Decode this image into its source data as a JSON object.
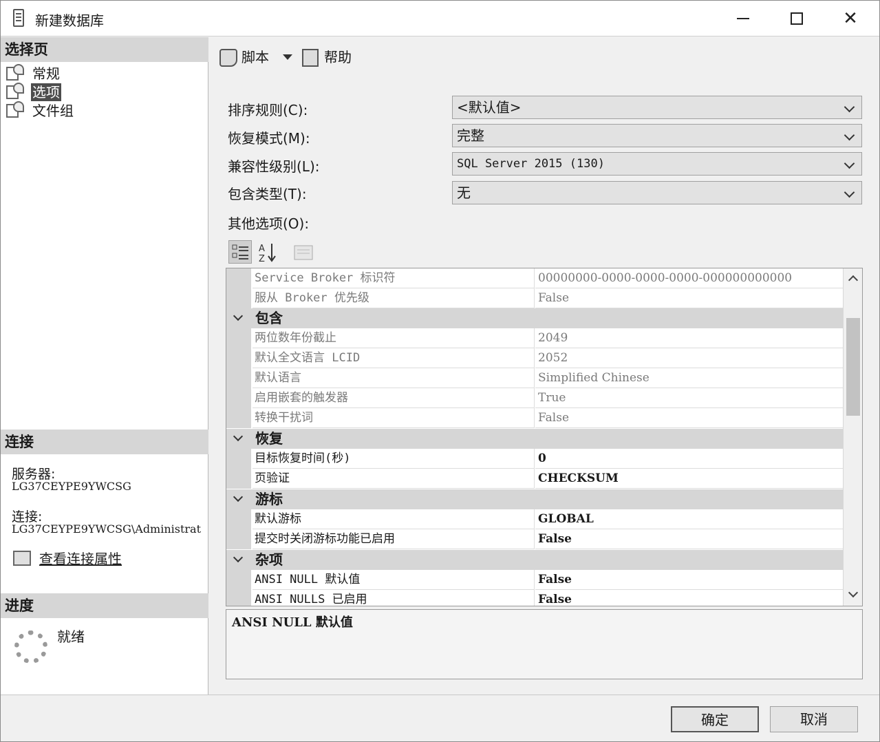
{
  "window": {
    "title": "新建数据库"
  },
  "left": {
    "select_page_header": "选择页",
    "nav_items": [
      {
        "label": "常规",
        "selected": false
      },
      {
        "label": "选项",
        "selected": true
      },
      {
        "label": "文件组",
        "selected": false
      }
    ],
    "connection_header": "连接",
    "server_label": "服务器:",
    "server_value": "LG37CEYPE9YWCSG",
    "connection_label": "连接:",
    "connection_value": "LG37CEYPE9YWCSG\\Administrat",
    "view_properties_link": "查看连接属性",
    "progress_header": "进度",
    "progress_status": "就绪"
  },
  "toolbar": {
    "script_label": "脚本",
    "help_label": "帮助"
  },
  "form": {
    "collation_label": "排序规则(C):",
    "collation_value": "<默认值>",
    "recovery_label": "恢复模式(M):",
    "recovery_value": "完整",
    "compat_label": "兼容性级别(L):",
    "compat_value": "SQL Server 2015 (130)",
    "containment_label": "包含类型(T):",
    "containment_value": "无",
    "other_label": "其他选项(O):"
  },
  "grid": {
    "rows": [
      {
        "kind": "prop",
        "name": "Service Broker 标识符",
        "value": "00000000-0000-0000-0000-000000000000",
        "readonly": true
      },
      {
        "kind": "prop",
        "name": "服从 Broker 优先级",
        "value": "False",
        "readonly": true
      },
      {
        "kind": "cat",
        "name": "包含"
      },
      {
        "kind": "prop",
        "name": "两位数年份截止",
        "value": "2049",
        "readonly": true
      },
      {
        "kind": "prop",
        "name": "默认全文语言 LCID",
        "value": "2052",
        "readonly": true
      },
      {
        "kind": "prop",
        "name": "默认语言",
        "value": "Simplified Chinese",
        "readonly": true
      },
      {
        "kind": "prop",
        "name": "启用嵌套的触发器",
        "value": "True",
        "readonly": true
      },
      {
        "kind": "prop",
        "name": "转换干扰词",
        "value": "False",
        "readonly": true
      },
      {
        "kind": "cat",
        "name": "恢复"
      },
      {
        "kind": "prop",
        "name": "目标恢复时间(秒)",
        "value": "0",
        "readonly": false
      },
      {
        "kind": "prop",
        "name": "页验证",
        "value": "CHECKSUM",
        "readonly": false
      },
      {
        "kind": "cat",
        "name": "游标"
      },
      {
        "kind": "prop",
        "name": "默认游标",
        "value": "GLOBAL",
        "readonly": false
      },
      {
        "kind": "prop",
        "name": "提交时关闭游标功能已启用",
        "value": "False",
        "readonly": false
      },
      {
        "kind": "cat",
        "name": "杂项"
      },
      {
        "kind": "prop",
        "name": "ANSI NULL 默认值",
        "value": "False",
        "readonly": false
      },
      {
        "kind": "prop",
        "name": "ANSI NULLS 已启用",
        "value": "False",
        "readonly": false
      }
    ],
    "description_title": "ANSI NULL 默认值"
  },
  "buttons": {
    "ok": "确定",
    "cancel": "取消"
  }
}
